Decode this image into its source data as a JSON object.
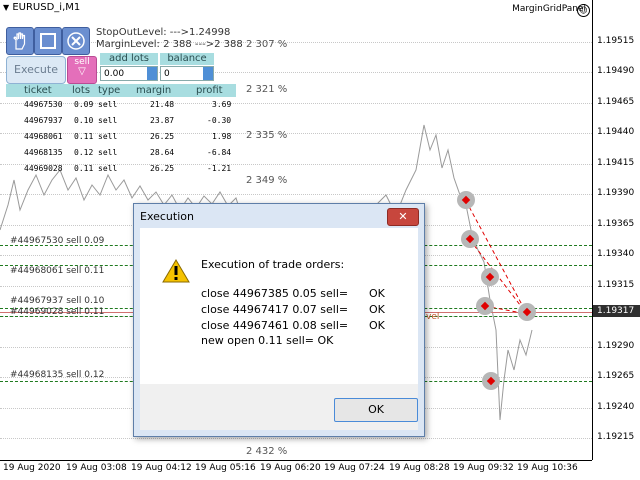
{
  "symbol_title": "EURUSD_i,M1",
  "panel_title": "MarginGridPanel",
  "info": {
    "stop_out": "StopOutLevel: --->1.24998",
    "margin_level": "MarginLevel:  2 388 --->2 388"
  },
  "controls": {
    "execute_label": "Execute",
    "sell_label": "sell",
    "add_lots_label": "add lots",
    "add_lots_value": "0.00",
    "balance_label": "balance",
    "balance_value": "0"
  },
  "table": {
    "headers": [
      "ticket",
      "lots",
      "type",
      "margin",
      "profit"
    ],
    "rows": [
      [
        "44967530",
        "0.09",
        "sell",
        "21.48",
        "3.69"
      ],
      [
        "44967937",
        "0.10",
        "sell",
        "23.87",
        "-0.30"
      ],
      [
        "44968061",
        "0.11",
        "sell",
        "26.25",
        "1.98"
      ],
      [
        "44968135",
        "0.12",
        "sell",
        "28.64",
        "-6.84"
      ],
      [
        "44969028",
        "0.11",
        "sell",
        "26.25",
        "-1.21"
      ]
    ]
  },
  "percent_levels": [
    "2 307 %",
    "2 321 %",
    "2 335 %",
    "2 349 %",
    "2 432 %"
  ],
  "order_labels": [
    "#44967530 sell 0.09",
    "#44968061 sell 0.11",
    "#44967937 sell 0.10",
    "#44969028 sell 0.11",
    "#44968135 sell 0.12"
  ],
  "partial_label": "vel",
  "price_axis": [
    "1.19515",
    "1.19490",
    "1.19465",
    "1.19440",
    "1.19415",
    "1.19390",
    "1.19365",
    "1.19340",
    "1.19315",
    "1.19290",
    "1.19265",
    "1.19240",
    "1.19215"
  ],
  "current_price": "1.19317",
  "time_axis": [
    "19 Aug 2020",
    "19 Aug 03:08",
    "19 Aug 04:12",
    "19 Aug 05:16",
    "19 Aug 06:20",
    "19 Aug 07:24",
    "19 Aug 08:28",
    "19 Aug 09:32",
    "19 Aug 10:36"
  ],
  "dialog": {
    "title": "Execution",
    "close_glyph": "✕",
    "heading": "Execution of trade orders:",
    "lines": [
      {
        "text": "close 44967385 0.05 sell=",
        "status": "OK"
      },
      {
        "text": "close 44967417 0.07 sell=",
        "status": "OK"
      },
      {
        "text": "close 44967461 0.08 sell=",
        "status": "OK"
      }
    ],
    "new_open": "new open  0.11 sell=  OK",
    "ok_label": "OK"
  },
  "colors": {
    "level_line": "#1f7a1f",
    "marker_arrow": "#e00000",
    "accent_blue": "#6b8fd0"
  }
}
